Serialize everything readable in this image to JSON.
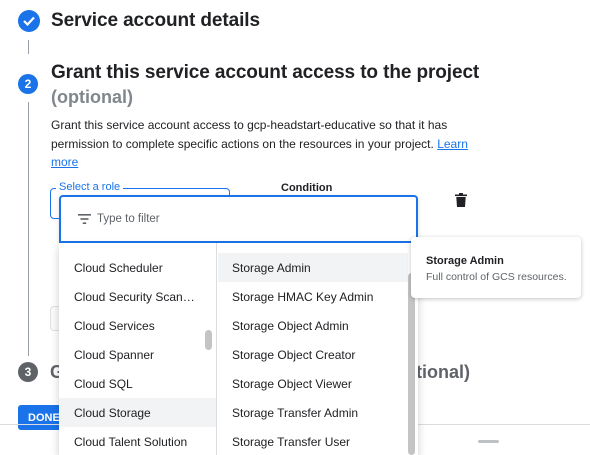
{
  "steps": {
    "step1": {
      "title": "Service account details"
    },
    "step2": {
      "number": "2",
      "title": "Grant this service account access to the project",
      "optional": "(optional)",
      "description": "Grant this service account access to gcp-headstart-educative so that it has permission to complete specific actions on the resources in your project.",
      "learn_more": "Learn more"
    },
    "step3": {
      "number": "3",
      "title_start": "G",
      "optional_end": "otional)"
    }
  },
  "role_selector": {
    "label": "Select a role",
    "condition_label": "Condition"
  },
  "filter": {
    "placeholder": "Type to filter",
    "value": ""
  },
  "services": [
    "Cloud Scheduler",
    "Cloud Security Scan…",
    "Cloud Services",
    "Cloud Spanner",
    "Cloud SQL",
    "Cloud Storage",
    "Cloud Talent Solution"
  ],
  "selected_service": "Cloud Storage",
  "roles": [
    "Storage Admin",
    "Storage HMAC Key Admin",
    "Storage Object Admin",
    "Storage Object Creator",
    "Storage Object Viewer",
    "Storage Transfer Admin",
    "Storage Transfer User"
  ],
  "selected_role": "Storage Admin",
  "tooltip": {
    "title": "Storage Admin",
    "body": "Full control of GCS resources."
  },
  "done_button": "DONE",
  "colors": {
    "accent": "#1a73e8",
    "step_inactive": "#5f6368",
    "text": "#202124",
    "muted": "#80868b"
  }
}
